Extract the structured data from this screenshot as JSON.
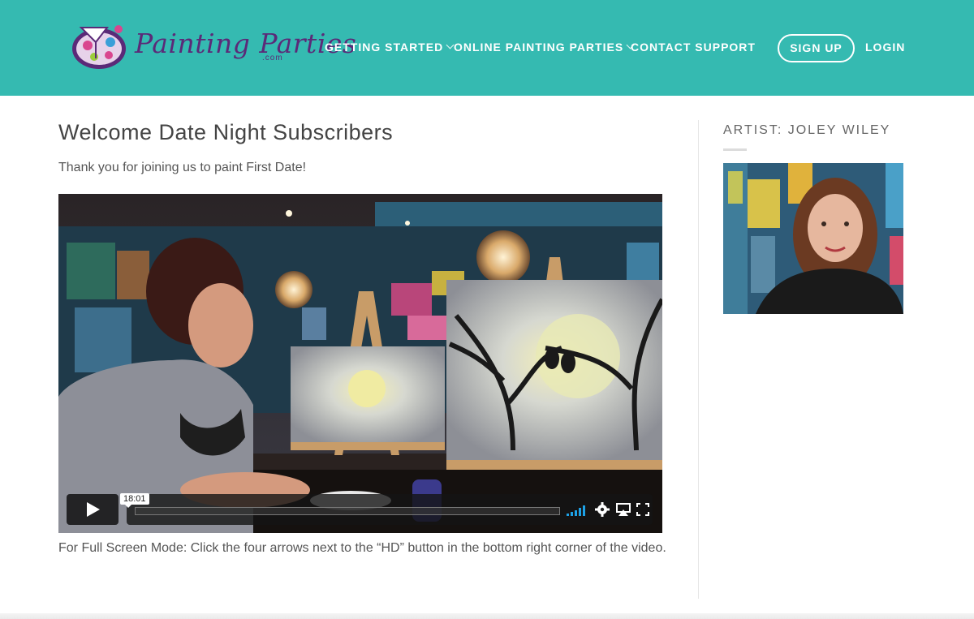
{
  "brand": {
    "name": "Painting Parties",
    "suffix": ".com",
    "colors": {
      "header_bg": "#35bab1",
      "logo_purple": "#5b2a78",
      "logo_pink": "#d9468f"
    }
  },
  "nav": {
    "items": [
      {
        "label": "GETTING STARTED",
        "has_dropdown": true,
        "icon": "chevron-down-icon"
      },
      {
        "label": "ONLINE PAINTING PARTIES",
        "has_dropdown": true,
        "icon": "chevron-down-icon"
      },
      {
        "label": "CONTACT SUPPORT",
        "has_dropdown": false
      }
    ],
    "signup_label": "SIGN UP",
    "login_label": "LOGIN"
  },
  "main": {
    "title": "Welcome Date Night Subscribers",
    "intro": "Thank you for joining us to paint First Date!",
    "caption": "For Full Screen Mode: Click the four arrows next to the “HD” button in the bottom right corner of the video."
  },
  "video": {
    "time_label": "18:01",
    "progress_fraction": 0.0,
    "icons": [
      "play-icon",
      "volume-bars-icon",
      "gear-icon",
      "airplay-icon",
      "fullscreen-icon"
    ]
  },
  "sidebar": {
    "artist_label": "ARTIST: JOLEY WILEY"
  }
}
